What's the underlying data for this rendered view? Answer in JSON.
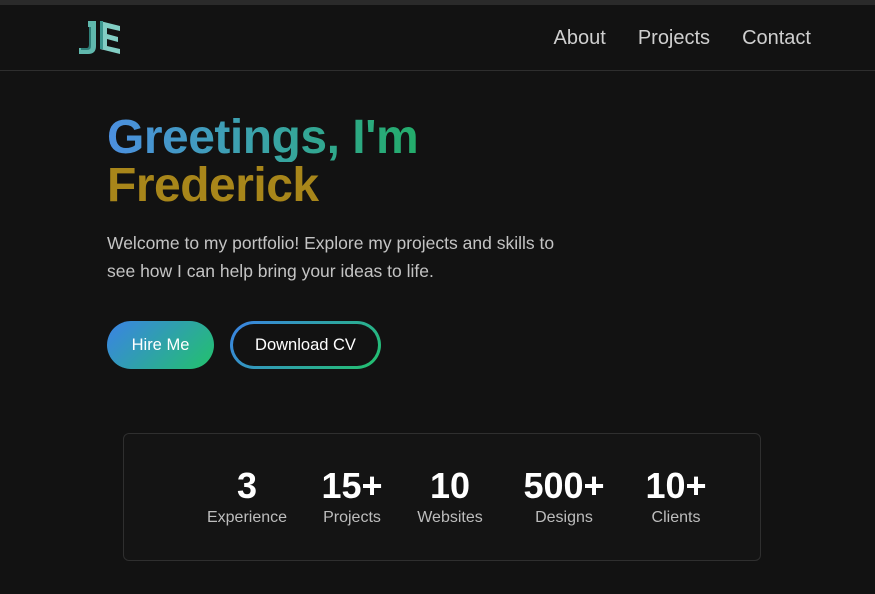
{
  "header": {
    "logo_text": "JE",
    "nav": [
      {
        "label": "About"
      },
      {
        "label": "Projects"
      },
      {
        "label": "Contact"
      }
    ]
  },
  "hero": {
    "line1": "Greetings, I'm",
    "line2": "Frederick",
    "description": "Welcome to my portfolio! Explore my projects and skills to see how I can help bring your ideas to life.",
    "hire_label": "Hire Me",
    "cv_label": "Download CV"
  },
  "stats": [
    {
      "value": "3",
      "label": "Experience"
    },
    {
      "value": "15+",
      "label": "Projects"
    },
    {
      "value": "10",
      "label": "Websites"
    },
    {
      "value": "500+",
      "label": "Designs"
    },
    {
      "value": "10+",
      "label": "Clients"
    }
  ],
  "colors": {
    "background": "#121212",
    "gradient_start": "#3b82e6",
    "gradient_end": "#22c26b",
    "name_gold": "#a8861a"
  }
}
